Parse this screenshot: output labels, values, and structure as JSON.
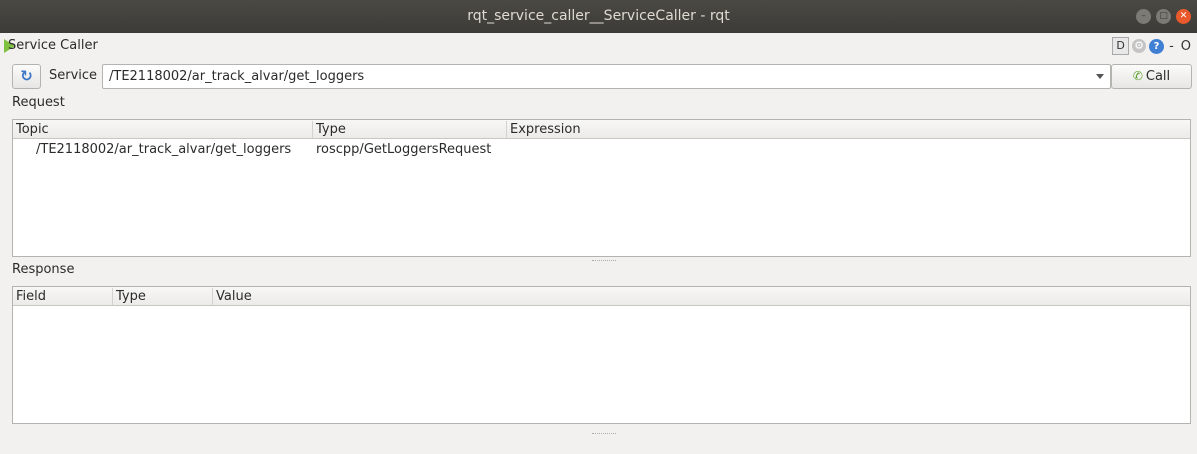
{
  "window": {
    "title": "rqt_service_caller__ServiceCaller - rqt"
  },
  "plugin": {
    "title": "Service Caller",
    "d_label": "D",
    "help_label": "?",
    "minimize_label": "-",
    "close_label": "O"
  },
  "toolbar": {
    "refresh_icon": "refresh-icon",
    "service_label": "Service",
    "service_value": "/TE2118002/ar_track_alvar/get_loggers",
    "call_label": "Call"
  },
  "request": {
    "section_label": "Request",
    "columns": [
      "Topic",
      "Type",
      "Expression"
    ],
    "rows": [
      {
        "topic": "/TE2118002/ar_track_alvar/get_loggers",
        "type": "roscpp/GetLoggersRequest",
        "expression": ""
      }
    ]
  },
  "response": {
    "section_label": "Response",
    "columns": [
      "Field",
      "Type",
      "Value"
    ],
    "rows": []
  }
}
